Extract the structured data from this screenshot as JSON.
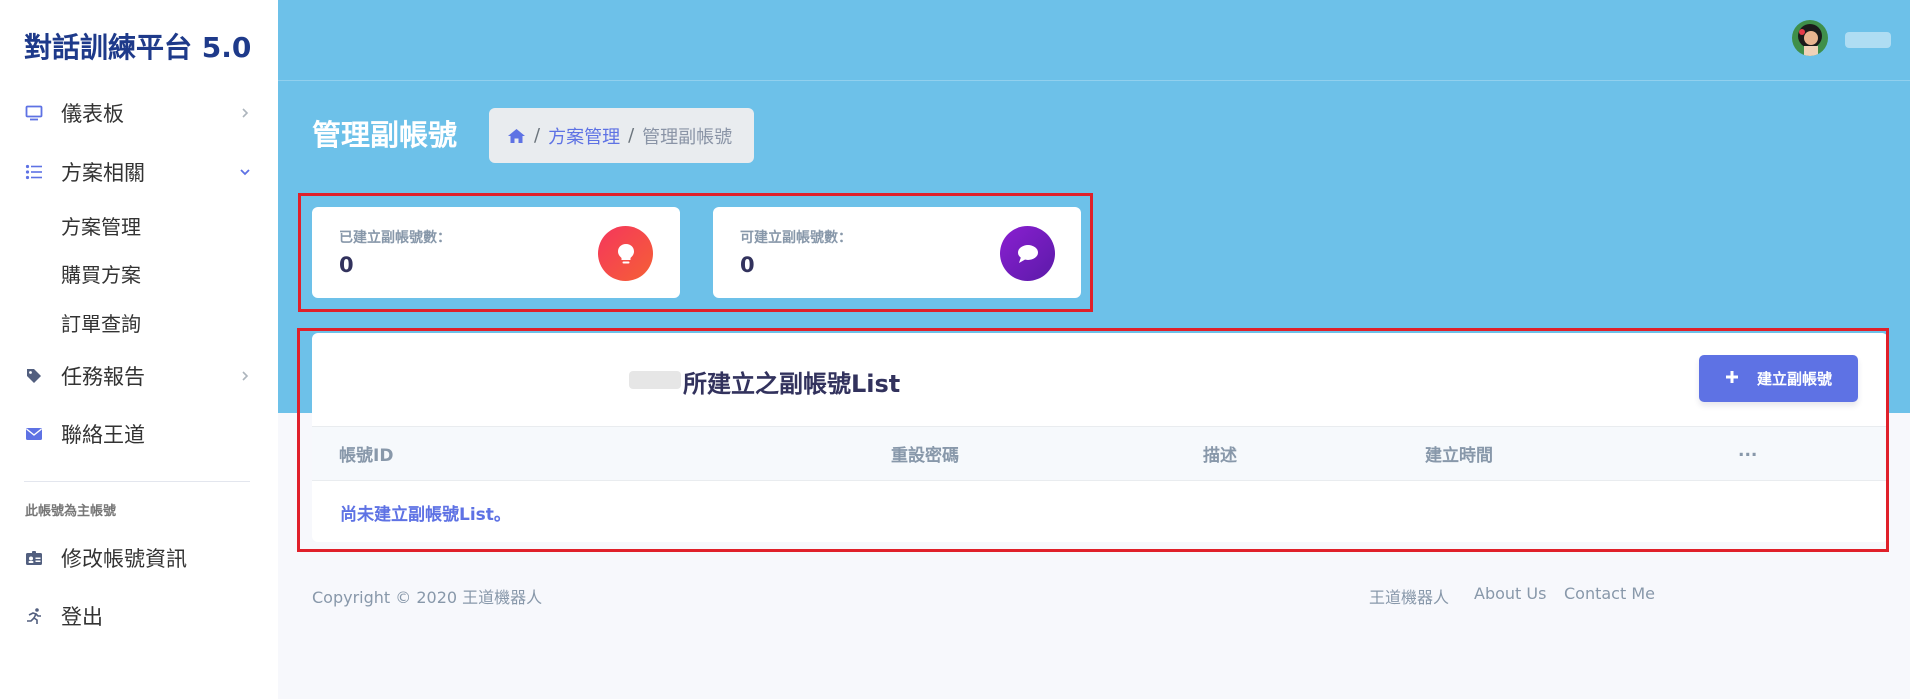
{
  "app": {
    "title": "對話訓練平台 5.0"
  },
  "sidebar": {
    "items": [
      {
        "label": "儀表板",
        "icon": "monitor-icon"
      },
      {
        "label": "方案相關",
        "icon": "list-icon"
      },
      {
        "label": "任務報告",
        "icon": "tag-icon"
      },
      {
        "label": "聯絡王道",
        "icon": "envelope-icon"
      }
    ],
    "subitems": [
      {
        "label": "方案管理"
      },
      {
        "label": "購買方案"
      },
      {
        "label": "訂單查詢"
      }
    ],
    "section_heading": "此帳號為主帳號",
    "account_items": [
      {
        "label": "修改帳號資訊",
        "icon": "id-card-icon"
      },
      {
        "label": "登出",
        "icon": "running-person-icon"
      }
    ]
  },
  "header": {
    "page_title": "管理副帳號",
    "breadcrumb": {
      "parent": "方案管理",
      "current": "管理副帳號",
      "separator": "/"
    }
  },
  "stats": [
    {
      "label": "已建立副帳號數：",
      "value": "0",
      "icon": "lightbulb-icon",
      "color": "#f5365c"
    },
    {
      "label": "可建立副帳號數：",
      "value": "0",
      "icon": "chat-bubble-icon",
      "color": "#8a1fd1"
    }
  ],
  "list": {
    "title": "所建立之副帳號List",
    "create_button": "建立副帳號",
    "columns": [
      "帳號ID",
      "重設密碼",
      "描述",
      "建立時間",
      "..."
    ],
    "empty_message": "尚未建立副帳號List。"
  },
  "footer": {
    "copyright": "Copyright © 2020 王道機器人",
    "links": [
      "王道機器人",
      "About Us",
      "Contact Me"
    ]
  },
  "colors": {
    "accent": "#5e72e4",
    "hero": "#6dc1e9",
    "highlight": "#e0202a"
  }
}
